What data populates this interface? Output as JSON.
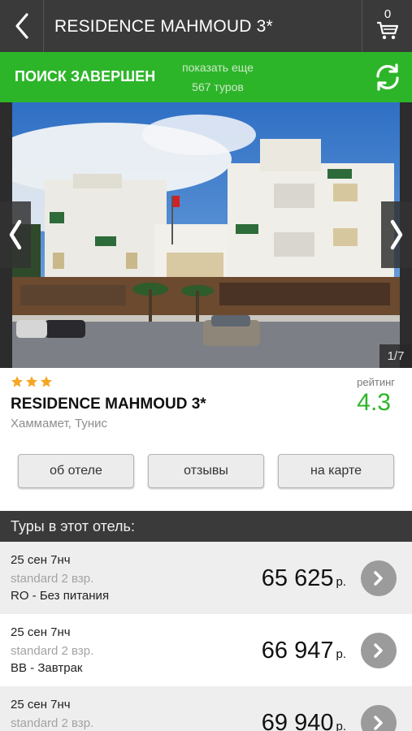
{
  "topbar": {
    "title": "RESIDENCE MAHMOUD 3*",
    "cart_count": "0"
  },
  "status": {
    "text": "ПОИСК ЗАВЕРШЕН",
    "more_line1": "показать еще",
    "more_line2": "567 туров"
  },
  "gallery": {
    "counter": "1/7"
  },
  "hotel": {
    "stars": 3,
    "name": "RESIDENCE MAHMOUD 3*",
    "location": "Хаммамет, Тунис",
    "rating_label": "рейтинг",
    "rating": "4.3"
  },
  "buttons": {
    "about": "об отеле",
    "reviews": "отзывы",
    "map": "на карте"
  },
  "tours_header": "Туры в этот отель:",
  "tours": [
    {
      "date": "25 сен 7нч",
      "room": "standard 2 взр.",
      "board": "RO - Без питания",
      "price": "65 625",
      "currency": "р."
    },
    {
      "date": "25 сен 7нч",
      "room": "standard 2 взр.",
      "board": "BB - Завтрак",
      "price": "66 947",
      "currency": "р."
    },
    {
      "date": "25 сен 7нч",
      "room": "standard 2 взр.",
      "board": "",
      "price": "69 940",
      "currency": "р."
    }
  ],
  "colors": {
    "accent_green": "#2db52a",
    "topbar": "#3a3a3a",
    "star": "#f5a623"
  },
  "icons": [
    "back-chevron-icon",
    "cart-icon",
    "refresh-icon",
    "gallery-left-icon",
    "gallery-right-icon",
    "star-icon",
    "chevron-right-icon"
  ]
}
